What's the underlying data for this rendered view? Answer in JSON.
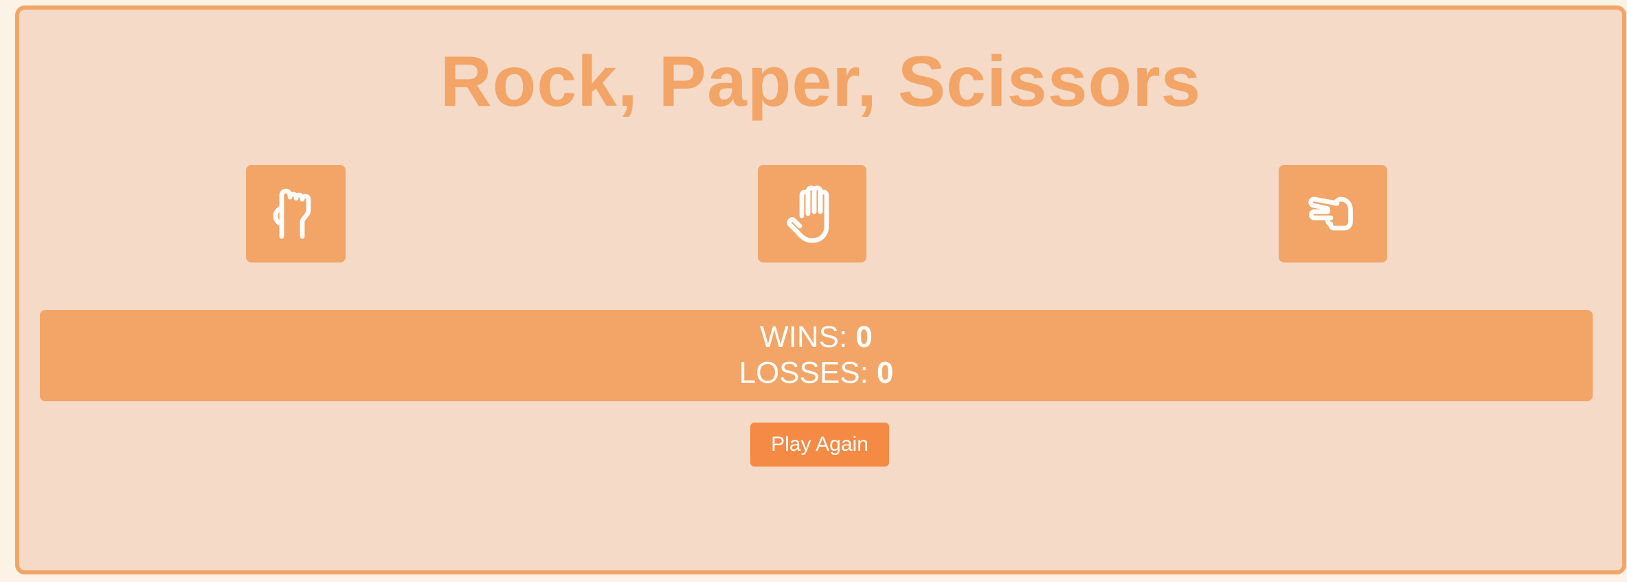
{
  "title": "Rock, Paper, Scissors",
  "choices": [
    {
      "id": "rock",
      "icon": "hand-rock-icon"
    },
    {
      "id": "paper",
      "icon": "hand-paper-icon"
    },
    {
      "id": "scissors",
      "icon": "hand-scissors-icon"
    }
  ],
  "score": {
    "wins_label": "WINS:",
    "wins": "0",
    "losses_label": "LOSSES:",
    "losses": "0"
  },
  "play_again_label": "Play Again",
  "colors": {
    "page_background": "#fcf2e6",
    "panel_background": "#f5dac7",
    "accent": "#f2a566",
    "button": "#f58a45",
    "text_light": "#ffffff"
  }
}
